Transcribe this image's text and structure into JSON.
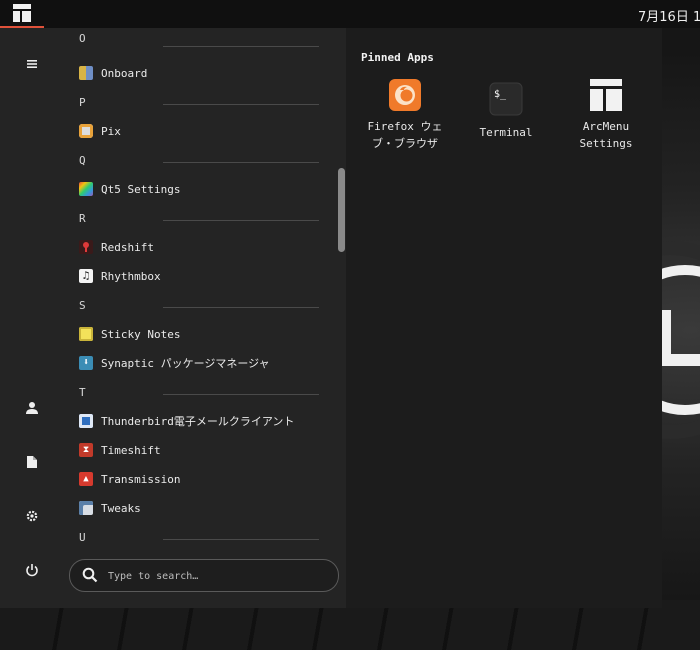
{
  "top_panel": {
    "clock": "7月16日 1"
  },
  "sidebar": {
    "items": [
      {
        "name": "hamburger-menu-icon"
      },
      {
        "name": "user-icon"
      },
      {
        "name": "document-icon"
      },
      {
        "name": "settings-gear-icon"
      },
      {
        "name": "power-icon"
      }
    ]
  },
  "app_list": {
    "sections": [
      {
        "letter": "O",
        "apps": [
          "Onboard"
        ]
      },
      {
        "letter": "P",
        "apps": [
          "Pix"
        ]
      },
      {
        "letter": "Q",
        "apps": [
          "Qt5 Settings"
        ]
      },
      {
        "letter": "R",
        "apps": [
          "Redshift",
          "Rhythmbox"
        ]
      },
      {
        "letter": "S",
        "apps": [
          "Sticky Notes",
          "Synaptic パッケージマネージャ"
        ]
      },
      {
        "letter": "T",
        "apps": [
          "Thunderbird電子メールクライアント",
          "Timeshift",
          "Transmission",
          "Tweaks"
        ]
      },
      {
        "letter": "U",
        "apps": []
      }
    ]
  },
  "search": {
    "placeholder": "Type to search…"
  },
  "pinned": {
    "title": "Pinned Apps",
    "apps": [
      {
        "label_line1": "Firefox ウェ",
        "label_line2": "ブ・ブラウザ",
        "icon": "firefox-icon"
      },
      {
        "label_line1": "Terminal",
        "label_line2": "",
        "icon": "terminal-icon"
      },
      {
        "label_line1": "ArcMenu",
        "label_line2": "Settings",
        "icon": "arcmenu-settings-icon"
      }
    ]
  },
  "colors": {
    "accent": "#e0513a",
    "menu_bg": "#242424",
    "panel_bg": "#101010"
  }
}
